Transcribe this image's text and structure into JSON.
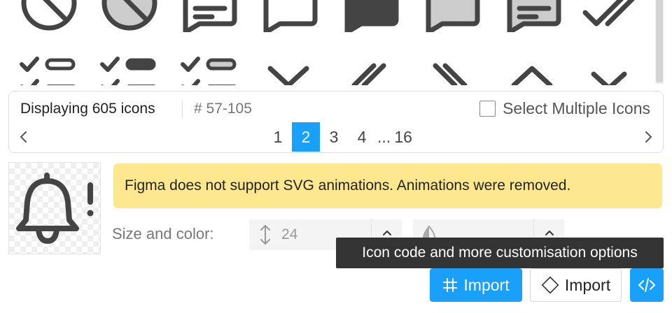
{
  "icon_grid": {
    "row1": [
      "circle-slash-outline-icon",
      "circle-slash-filled-icon",
      "message-text-outline-icon",
      "message-outline-icon",
      "message-filled-icon",
      "message-filled-light-icon",
      "message-text-filled-light-icon",
      "double-check-icon"
    ],
    "row2": [
      "list-check-outline-icon",
      "list-check-filled-icon",
      "list-check-light-icon",
      "chevron-down-icon",
      "double-slash-icon",
      "double-backslash-icon",
      "chevron-up-icon",
      "chevron-down-icon"
    ]
  },
  "info": {
    "count": "Displaying 605 icons",
    "range": "# 57-105",
    "select_multiple": "Select Multiple Icons"
  },
  "pagination": {
    "pages": [
      "1",
      "2",
      "3",
      "4"
    ],
    "current": "2",
    "ellipsis": "...",
    "last": "16"
  },
  "preview": {
    "icon": "bell-alert-icon",
    "warning": "Figma does not support SVG animations. Animations were removed."
  },
  "controls": {
    "size_label": "Size and color:",
    "size_value": "24",
    "tooltip": "Icon code and more customisation options"
  },
  "buttons": {
    "figma_import": "Import",
    "frame_import": "Import"
  },
  "colors": {
    "accent": "#18a0fb",
    "warning_bg": "#fde88f",
    "tooltip_bg": "#333333",
    "icon_dark": "#444444",
    "icon_fill_light": "#cccccc"
  }
}
